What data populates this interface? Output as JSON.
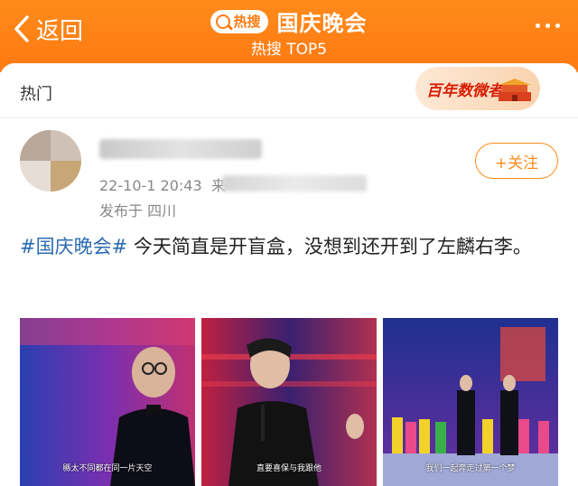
{
  "header": {
    "back_label": "返回",
    "hot_pill_label": "热搜",
    "title": "国庆晚会",
    "subtitle": "热搜 TOP5"
  },
  "tabs": {
    "hot_label": "热门"
  },
  "banner": {
    "text": "百年数微者"
  },
  "post": {
    "time": "22-10-1 20:43",
    "from_prefix": "来",
    "location": "发布于 四川",
    "follow_label": "+关注",
    "hashtag": "#国庆晚会#",
    "body": " 今天简直是开盲盒，没想到还开到了左麟右李。",
    "photos": [
      {
        "caption": "縣太不同都在同一片天空"
      },
      {
        "caption": "直要喜保与我跟他"
      },
      {
        "caption": "我们一起奔走过第一个梦"
      }
    ]
  },
  "colors": {
    "accent": "#ff8a1a",
    "hashtag": "#2b6cb0"
  }
}
